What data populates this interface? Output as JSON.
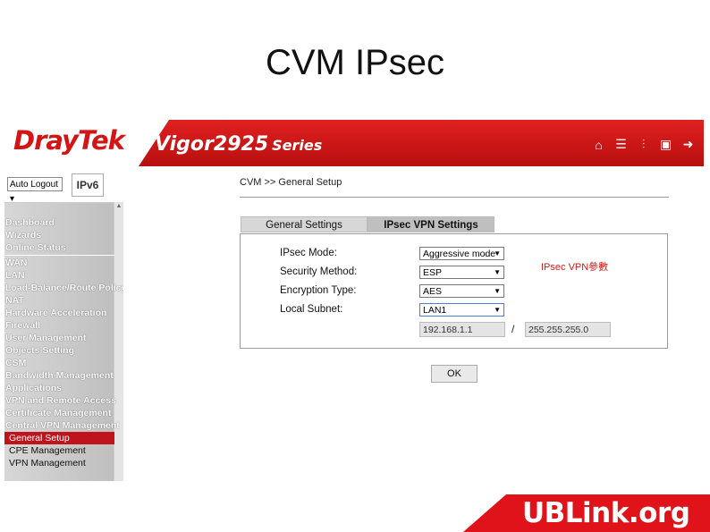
{
  "slide": {
    "title": "CVM IPsec"
  },
  "router": {
    "brand": "DrayTek",
    "model": "Vigor2925",
    "series": "Series",
    "header_icons": [
      "home-icon",
      "list-icon",
      "sliders-icon",
      "save-icon",
      "logout-icon"
    ]
  },
  "sidebar": {
    "auto_logout": "Auto Logout",
    "ipv6_label": "IPv6",
    "group1": [
      "Dashboard",
      "Wizards",
      "Online Status"
    ],
    "group2": [
      "WAN",
      "LAN",
      "Load-Balance/Route Policy",
      "NAT",
      "Hardware Acceleration",
      "Firewall",
      "User Management",
      "Objects Setting",
      "CSM",
      "Bandwidth Management",
      "Applications",
      "VPN and Remote Access",
      "Certificate Management",
      "Central VPN Management"
    ],
    "sub": [
      "General Setup",
      "CPE Management",
      "VPN Management"
    ],
    "active_item": "General Setup"
  },
  "main": {
    "breadcrumb": "CVM >> General Setup",
    "tabs": [
      {
        "label": "General Settings"
      },
      {
        "label": "IPsec VPN Settings",
        "active": true
      }
    ],
    "fields": [
      {
        "label": "IPsec Mode:",
        "value": "Aggressive mode"
      },
      {
        "label": "Security Method:",
        "value": "ESP"
      },
      {
        "label": "Encryption Type:",
        "value": "AES"
      },
      {
        "label": "Local Subnet:",
        "value": "LAN1"
      }
    ],
    "ip": "192.168.1.1",
    "separator": "/",
    "mask": "255.255.255.0",
    "note": "IPsec VPN參數",
    "ok_label": "OK"
  },
  "footer": {
    "brand": "UBLink.org"
  },
  "colors": {
    "accent": "#d31515",
    "sidebar_bg": "#c8c8c8",
    "active": "#c0141c"
  }
}
